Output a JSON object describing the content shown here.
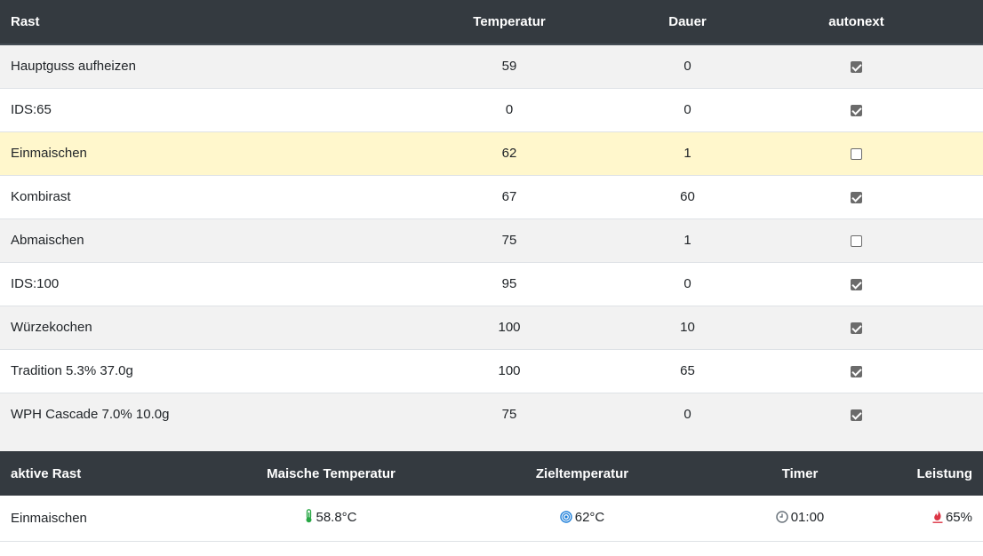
{
  "steps_table": {
    "headers": {
      "rast": "Rast",
      "temperatur": "Temperatur",
      "dauer": "Dauer",
      "autonext": "autonext"
    },
    "rows": [
      {
        "name": "Hauptguss aufheizen",
        "temperatur": "59",
        "dauer": "0",
        "autonext": true
      },
      {
        "name": "IDS:65",
        "temperatur": "0",
        "dauer": "0",
        "autonext": true
      },
      {
        "name": "Einmaischen",
        "temperatur": "62",
        "dauer": "1",
        "autonext": false
      },
      {
        "name": "Kombirast",
        "temperatur": "67",
        "dauer": "60",
        "autonext": true
      },
      {
        "name": "Abmaischen",
        "temperatur": "75",
        "dauer": "1",
        "autonext": false
      },
      {
        "name": "IDS:100",
        "temperatur": "95",
        "dauer": "0",
        "autonext": true
      },
      {
        "name": "Würzekochen",
        "temperatur": "100",
        "dauer": "10",
        "autonext": true
      },
      {
        "name": "Tradition 5.3% 37.0g",
        "temperatur": "100",
        "dauer": "65",
        "autonext": true
      },
      {
        "name": "WPH Cascade 7.0% 10.0g",
        "temperatur": "75",
        "dauer": "0",
        "autonext": true
      }
    ]
  },
  "status_table": {
    "headers": {
      "aktive_rast": "aktive Rast",
      "maische_temperatur": "Maische Temperatur",
      "zieltemperatur": "Zieltemperatur",
      "timer": "Timer",
      "leistung": "Leistung"
    },
    "values": {
      "aktive_rast": "Einmaischen",
      "maische_temperatur": "58.8°C",
      "zieltemperatur": "62°C",
      "timer": "01:00",
      "leistung": "65%"
    },
    "icons": {
      "maische_temperatur": "thermometer-icon",
      "zieltemperatur": "target-icon",
      "timer": "clock-icon",
      "leistung": "flame-icon"
    }
  },
  "colors": {
    "header_bg": "#343a40",
    "active_row_bg": "#fff7cc",
    "thermometer": "#28a745",
    "target": "#1e7fd9",
    "clock": "#6c757d",
    "flame": "#dc3545"
  }
}
